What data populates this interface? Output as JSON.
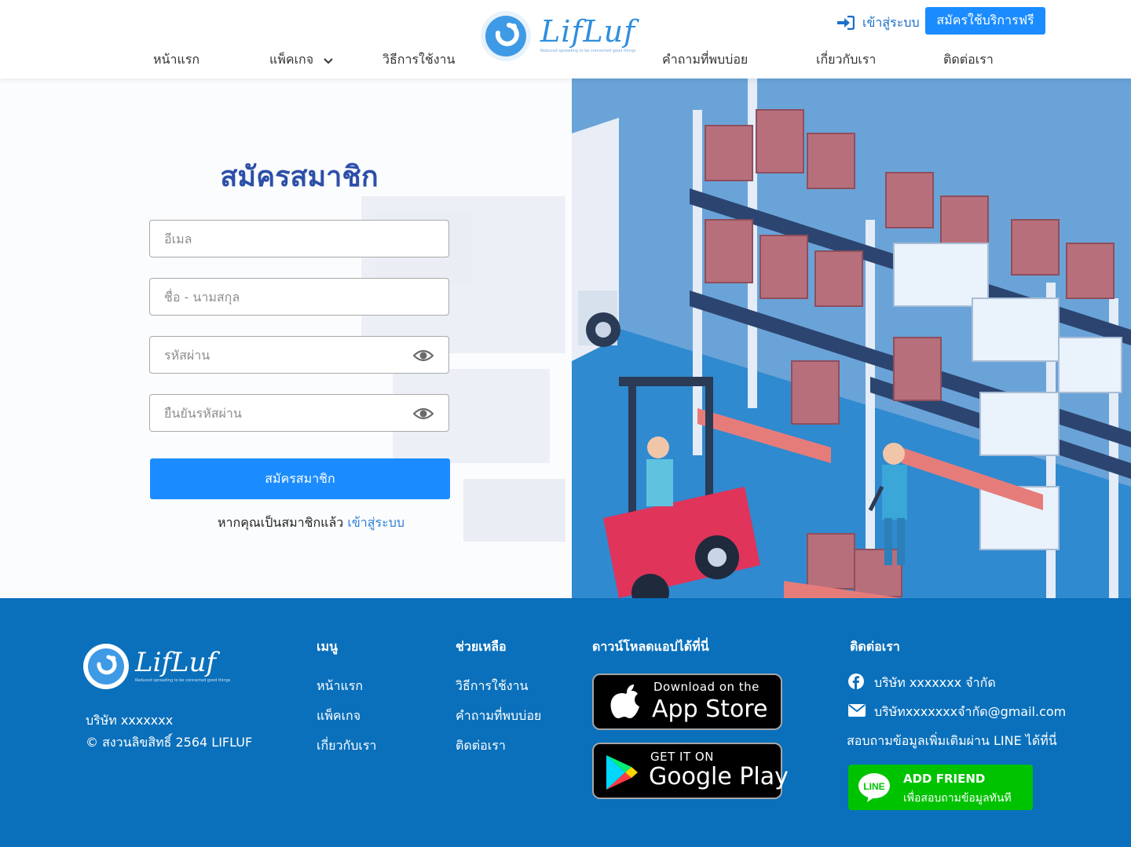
{
  "header": {
    "nav": {
      "home": "หน้าแรก",
      "packages": "แพ็คเกจ",
      "how_to": "วิธีการใช้งาน",
      "faq": "คำถามที่พบบ่อย",
      "about": "เกี่ยวกับเรา",
      "contact": "ติดต่อเรา"
    },
    "logo": {
      "name": "LifLuf",
      "tagline": "Reduced spreading to be connected good things"
    },
    "login_label": "เข้าสู่ระบบ",
    "signup_label": "สมัครใช้บริการฟรี"
  },
  "form": {
    "title": "สมัครสมาชิก",
    "email_placeholder": "อีเมล",
    "name_placeholder": "ชื่อ - นามสกุล",
    "password_placeholder": "รหัสผ่าน",
    "confirm_placeholder": "ยืนยันรหัสผ่าน",
    "submit_label": "สมัครสมาชิก",
    "have_account_text": "หากคุณเป็นสมาชิกแล้ว",
    "login_link": "เข้าสู่ระบบ"
  },
  "footer": {
    "company_name": "บริษัท xxxxxxx",
    "copyright": "© สงวนลิขสิทธิ์ 2564 LIFLUF",
    "menu": {
      "heading": "เมนู",
      "items": [
        "หน้าแรก",
        "แพ็คเกจ",
        "เกี่ยวกับเรา"
      ]
    },
    "help": {
      "heading": "ช่วยเหลือ",
      "items": [
        "วิธีการใช้งาน",
        "คำถามที่พบบ่อย",
        "ติดต่อเรา"
      ]
    },
    "download": {
      "heading": "ดาวน์โหลดแอปได้ที่นี่",
      "appstore_small": "Download on the",
      "appstore_big": "App Store",
      "googleplay_small": "GET IT ON",
      "googleplay_big": "Google Play"
    },
    "contact": {
      "heading": "ติดต่อเรา",
      "facebook": "บริษัท xxxxxxx  จำกัด",
      "email": "บริษัทxxxxxxxจำกัด@gmail.com",
      "line_prompt": "สอบถามข้อมูลเพิ่มเติมผ่าน LINE ได้ที่นี่",
      "line_badge": "LINE",
      "line_add": "ADD FRIEND",
      "line_sub": "เพื่อสอบถามข้อมูลทันที"
    }
  },
  "colors": {
    "primary_button": "#1b8cff",
    "title_blue": "#2c4fa8",
    "footer_bg": "#0a70bb",
    "line_green": "#00c300"
  },
  "icons": [
    "sign-in-icon",
    "chevron-down-icon",
    "eye-icon",
    "apple-icon",
    "google-play-icon",
    "facebook-icon",
    "envelope-icon",
    "line-icon"
  ]
}
